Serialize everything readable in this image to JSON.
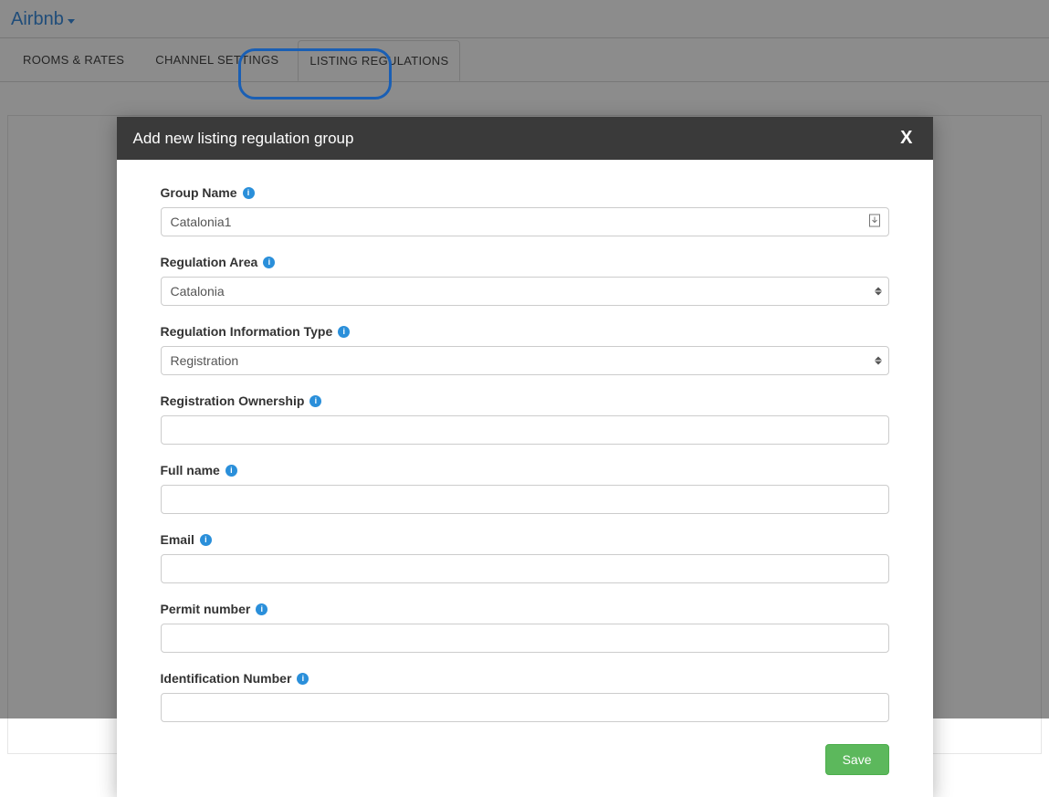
{
  "header": {
    "brand": "Airbnb"
  },
  "tabs": [
    {
      "label": "ROOMS & RATES",
      "active": false
    },
    {
      "label": "CHANNEL SETTINGS",
      "active": false
    },
    {
      "label": "LISTING REGULATIONS",
      "active": true
    }
  ],
  "modal": {
    "title": "Add new listing regulation group",
    "close_label": "X",
    "save_label": "Save",
    "fields": {
      "group_name": {
        "label": "Group Name",
        "value": "Catalonia1"
      },
      "regulation_area": {
        "label": "Regulation Area",
        "value": "Catalonia"
      },
      "regulation_info_type": {
        "label": "Regulation Information Type",
        "value": "Registration"
      },
      "registration_ownership": {
        "label": "Registration Ownership",
        "value": ""
      },
      "full_name": {
        "label": "Full name",
        "value": ""
      },
      "email": {
        "label": "Email",
        "value": ""
      },
      "permit_number": {
        "label": "Permit number",
        "value": ""
      },
      "identification_number": {
        "label": "Identification Number",
        "value": ""
      }
    }
  }
}
